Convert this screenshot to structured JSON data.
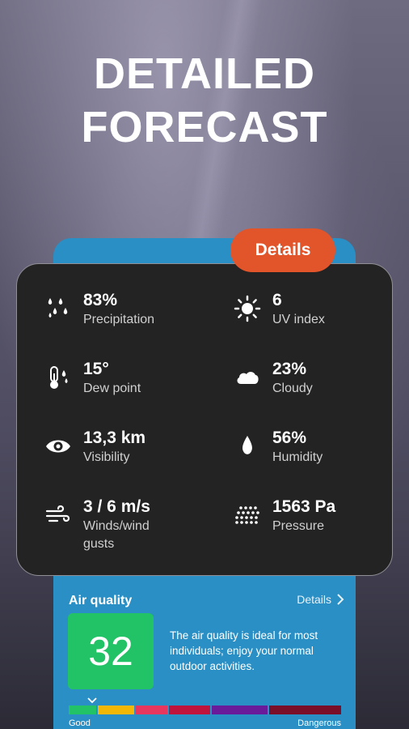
{
  "headline": {
    "line1": "DETAILED",
    "line2": "FORECAST"
  },
  "details_button": "Details",
  "metrics": [
    {
      "value": "83%",
      "label": "Precipitation",
      "icon": "raindrops-icon"
    },
    {
      "value": "6",
      "label": "UV index",
      "icon": "sun-icon"
    },
    {
      "value": "15°",
      "label": "Dew point",
      "icon": "thermometer-icon"
    },
    {
      "value": "23%",
      "label": "Cloudy",
      "icon": "cloud-icon"
    },
    {
      "value": "13,3 km",
      "label": "Visibility",
      "icon": "eye-icon"
    },
    {
      "value": "56%",
      "label": "Humidity",
      "icon": "drop-icon"
    },
    {
      "value": "3 / 6 m/s",
      "label": "Winds/wind gusts",
      "icon": "wind-icon"
    },
    {
      "value": "1563 Pa",
      "label": "Pressure",
      "icon": "pressure-icon"
    }
  ],
  "air_quality": {
    "title": "Air quality",
    "details_link": "Details",
    "index": "32",
    "description": "The air quality is ideal for most individuals; enjoy your normal outdoor activities.",
    "scale_low": "Good",
    "scale_high": "Dangerous",
    "scale_colors": [
      "#22c266",
      "#f2b705",
      "#e8375e",
      "#c0143c",
      "#6a1b9a",
      "#7a0f2a"
    ]
  },
  "colors": {
    "accent": "#e2552b",
    "card": "#232323",
    "air_panel": "#2a8fc4",
    "good": "#22c266"
  }
}
